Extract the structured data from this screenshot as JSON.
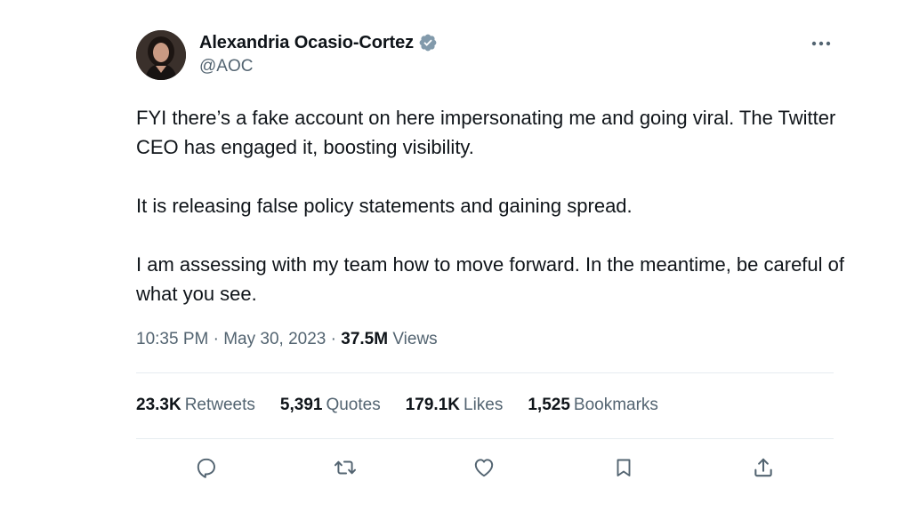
{
  "author": {
    "display_name": "Alexandria Ocasio-Cortez",
    "handle": "@AOC",
    "verified": true
  },
  "tweet": {
    "paragraphs": [
      "FYI there’s a fake account on here impersonating me and going viral. The Twitter CEO has engaged it, boosting visibility.",
      "It is releasing false policy statements and gaining spread.",
      "I am assessing with my team how to move forward. In the meantime, be careful of what you see."
    ],
    "time": "10:35 PM",
    "separator": "·",
    "date": "May 30, 2023",
    "views_count": "37.5M",
    "views_label": "Views"
  },
  "stats": {
    "retweets": {
      "count": "23.3K",
      "label": "Retweets"
    },
    "quotes": {
      "count": "5,391",
      "label": "Quotes"
    },
    "likes": {
      "count": "179.1K",
      "label": "Likes"
    },
    "bookmarks": {
      "count": "1,525",
      "label": "Bookmarks"
    }
  },
  "colors": {
    "text_primary": "#0f1419",
    "text_secondary": "#536471",
    "verified_badge": "#829aab",
    "divider": "#e6ecf0"
  },
  "icons": {
    "more": "more-dots-icon",
    "verified": "verified-badge-icon",
    "reply": "reply-icon",
    "retweet": "retweet-icon",
    "like": "heart-icon",
    "bookmark": "bookmark-icon",
    "share": "share-icon"
  }
}
